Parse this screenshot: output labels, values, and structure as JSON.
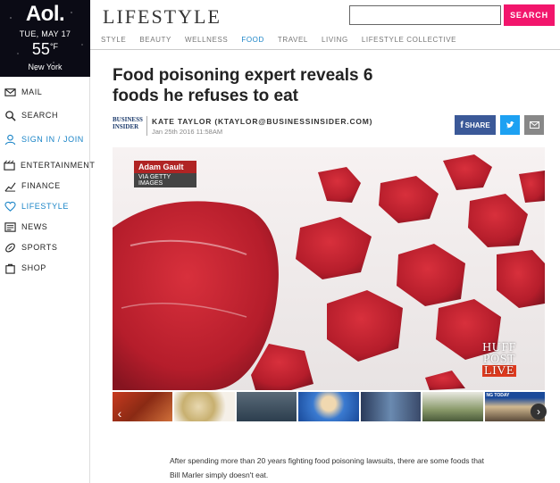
{
  "weather": {
    "logo": "Aol.",
    "date": "TUE, MAY 17",
    "temp": "55",
    "unit": "°F",
    "city": "New York"
  },
  "nav": [
    {
      "label": "MAIL",
      "icon": "mail-icon"
    },
    {
      "label": "SEARCH",
      "icon": "search-icon"
    },
    {
      "label": "SIGN IN / JOIN",
      "icon": "user-icon"
    },
    {
      "label": "ENTERTAINMENT",
      "icon": "film-icon"
    },
    {
      "label": "FINANCE",
      "icon": "chart-icon"
    },
    {
      "label": "LIFESTYLE",
      "icon": "heart-icon"
    },
    {
      "label": "NEWS",
      "icon": "news-icon"
    },
    {
      "label": "SPORTS",
      "icon": "football-icon"
    },
    {
      "label": "SHOP",
      "icon": "bag-icon"
    }
  ],
  "header": {
    "brand": "LIFESTYLE",
    "search_placeholder": "",
    "search_button": "SEARCH"
  },
  "categories": [
    "STYLE",
    "BEAUTY",
    "WELLNESS",
    "FOOD",
    "TRAVEL",
    "LIVING",
    "LIFESTYLE COLLECTIVE"
  ],
  "active_category": "FOOD",
  "article": {
    "headline": "Food poisoning expert reveals 6 foods he refuses to eat",
    "source_logo": "BUSINESS INSIDER",
    "author": "KATE TAYLOR (KTAYLOR@BUSINESSINSIDER.COM)",
    "date": "Jan 25th 2016 11:58AM",
    "share_label": "SHARE",
    "photo_credit": "Adam Gault",
    "photo_source": "VIA GETTY IMAGES",
    "watermark": [
      "HUFF",
      "POST",
      "LIVE"
    ],
    "thumb_caption": "NG TODAY",
    "body": "After spending more than 20 years fighting food poisoning lawsuits, there are some foods that Bill Marler simply doesn't eat."
  },
  "colors": {
    "accent": "#f2156c",
    "link": "#1a84c7",
    "facebook": "#3b5998",
    "twitter": "#1da1f2"
  }
}
